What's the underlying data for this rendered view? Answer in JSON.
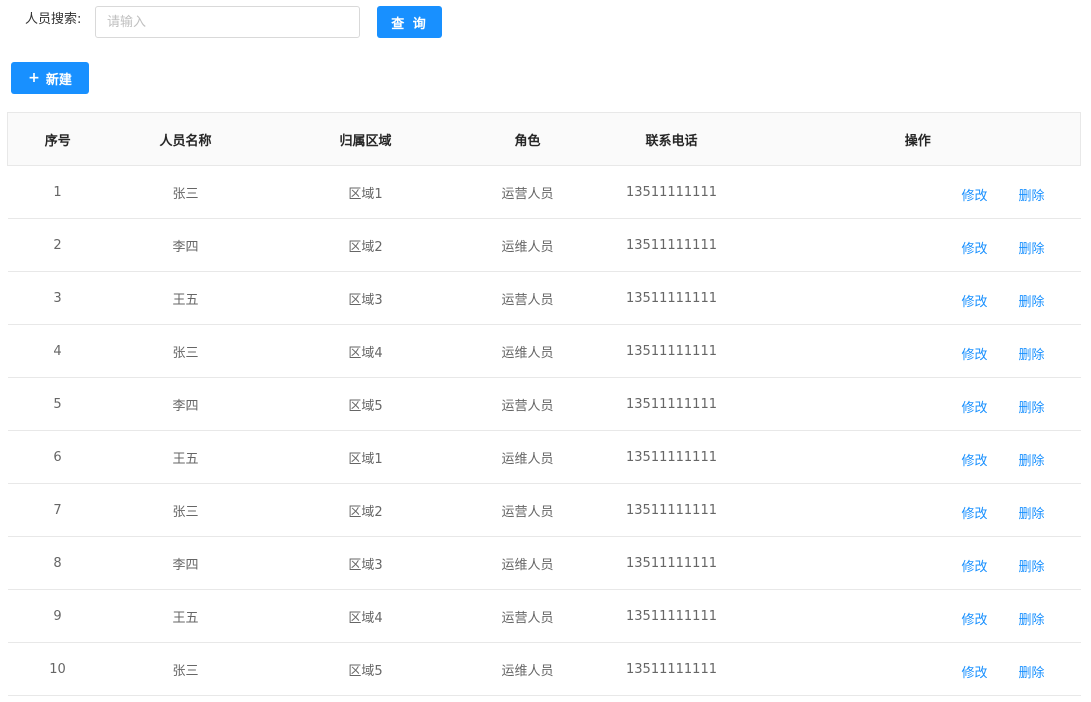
{
  "search": {
    "label": "人员搜索:",
    "placeholder": "请输入",
    "value": "",
    "query_label": "查 询"
  },
  "toolbar": {
    "new_label": "新建",
    "new_icon": "plus-icon"
  },
  "table": {
    "columns": [
      "序号",
      "人员名称",
      "归属区域",
      "角色",
      "联系电话",
      "操作"
    ],
    "action_labels": {
      "edit": "修改",
      "delete": "删除"
    },
    "rows": [
      {
        "index": "1",
        "name": "张三",
        "area": "区域1",
        "role": "运营人员",
        "phone": "13511111111"
      },
      {
        "index": "2",
        "name": "李四",
        "area": "区域2",
        "role": "运维人员",
        "phone": "13511111111"
      },
      {
        "index": "3",
        "name": "王五",
        "area": "区域3",
        "role": "运营人员",
        "phone": "13511111111"
      },
      {
        "index": "4",
        "name": "张三",
        "area": "区域4",
        "role": "运维人员",
        "phone": "13511111111"
      },
      {
        "index": "5",
        "name": "李四",
        "area": "区域5",
        "role": "运营人员",
        "phone": "13511111111"
      },
      {
        "index": "6",
        "name": "王五",
        "area": "区域1",
        "role": "运维人员",
        "phone": "13511111111"
      },
      {
        "index": "7",
        "name": "张三",
        "area": "区域2",
        "role": "运营人员",
        "phone": "13511111111"
      },
      {
        "index": "8",
        "name": "李四",
        "area": "区域3",
        "role": "运维人员",
        "phone": "13511111111"
      },
      {
        "index": "9",
        "name": "王五",
        "area": "区域4",
        "role": "运营人员",
        "phone": "13511111111"
      },
      {
        "index": "10",
        "name": "张三",
        "area": "区域5",
        "role": "运维人员",
        "phone": "13511111111"
      }
    ]
  },
  "colors": {
    "primary": "#1890ff",
    "header_bg": "#fafafa",
    "border": "#e8e8e8"
  }
}
